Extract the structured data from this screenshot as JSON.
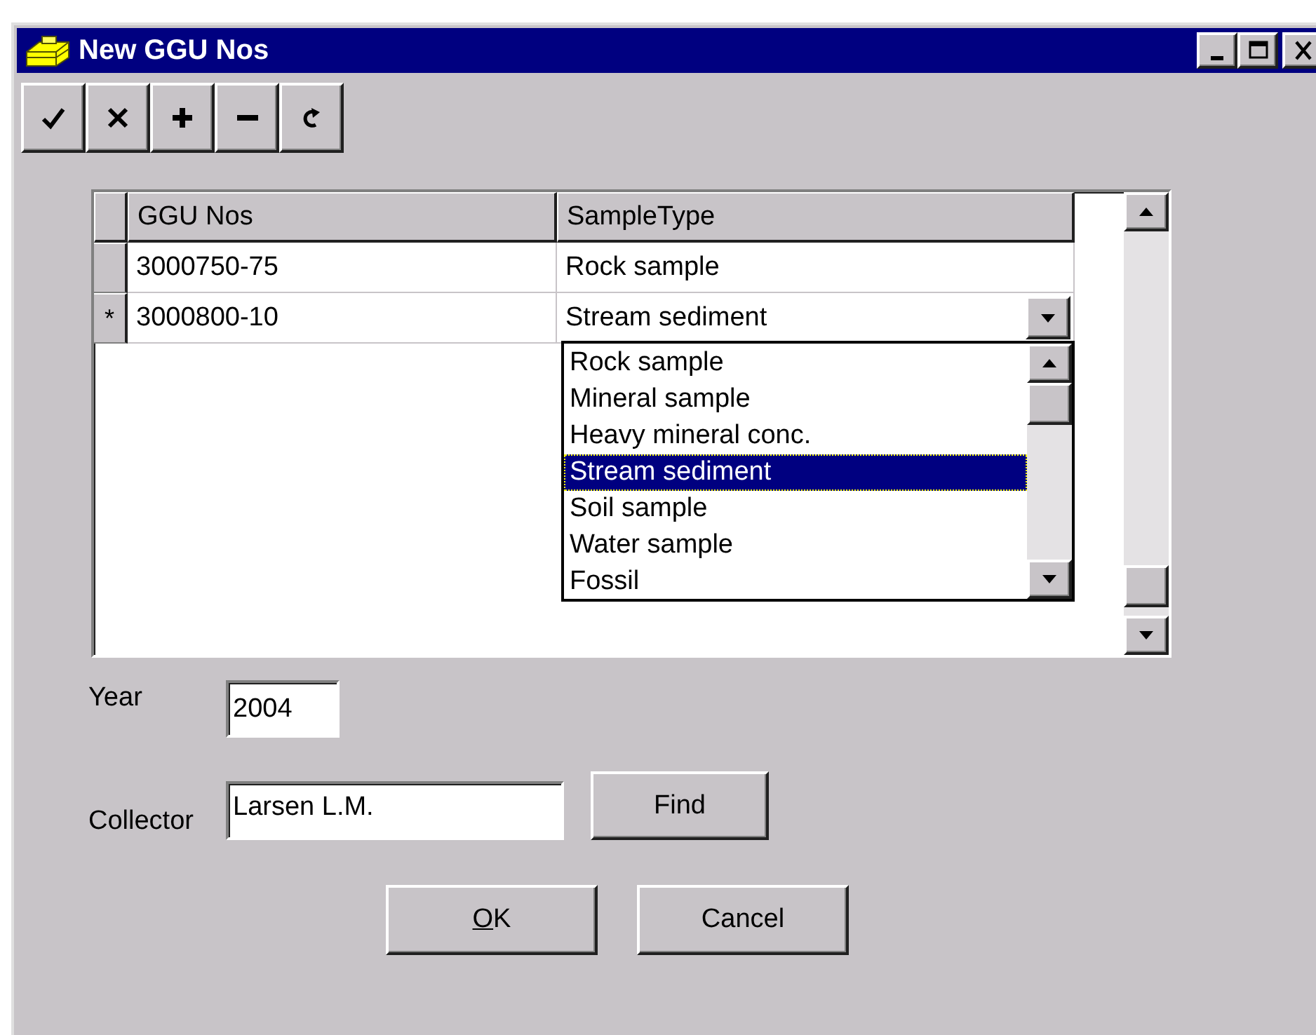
{
  "window": {
    "title": "New GGU Nos",
    "controls": [
      {
        "kind": "minimize"
      },
      {
        "kind": "maximize"
      },
      {
        "kind": "close"
      }
    ]
  },
  "toolbar": [
    {
      "kind": "check"
    },
    {
      "kind": "cross"
    },
    {
      "kind": "plus"
    },
    {
      "kind": "minus"
    },
    {
      "kind": "redo"
    }
  ],
  "grid": {
    "columns": [
      "GGU Nos",
      "SampleType"
    ],
    "rows": [
      {
        "ggu_nos": "3000750-75",
        "sample_type": "Rock sample",
        "dropdown_open": false
      },
      {
        "indicator": "*",
        "ggu_nos": "3000800-10",
        "sample_type": "Stream sediment",
        "dropdown_open": true
      }
    ],
    "dropdown": [
      {
        "label": "Rock sample",
        "selected": false
      },
      {
        "label": "Mineral sample",
        "selected": false
      },
      {
        "label": "Heavy mineral conc.",
        "selected": false
      },
      {
        "label": "Stream sediment",
        "selected": true
      },
      {
        "label": "Soil sample",
        "selected": false
      },
      {
        "label": "Water sample",
        "selected": false
      },
      {
        "label": "Fossil",
        "selected": false
      }
    ]
  },
  "form": {
    "year": {
      "label": "Year",
      "value": "2004"
    },
    "collector": {
      "label": "Collector",
      "value": "Larsen L.M."
    },
    "find_button": "Find"
  },
  "buttons": [
    {
      "label": "OK",
      "underline_first": true
    },
    {
      "label": "Cancel",
      "underline_first": false
    }
  ]
}
